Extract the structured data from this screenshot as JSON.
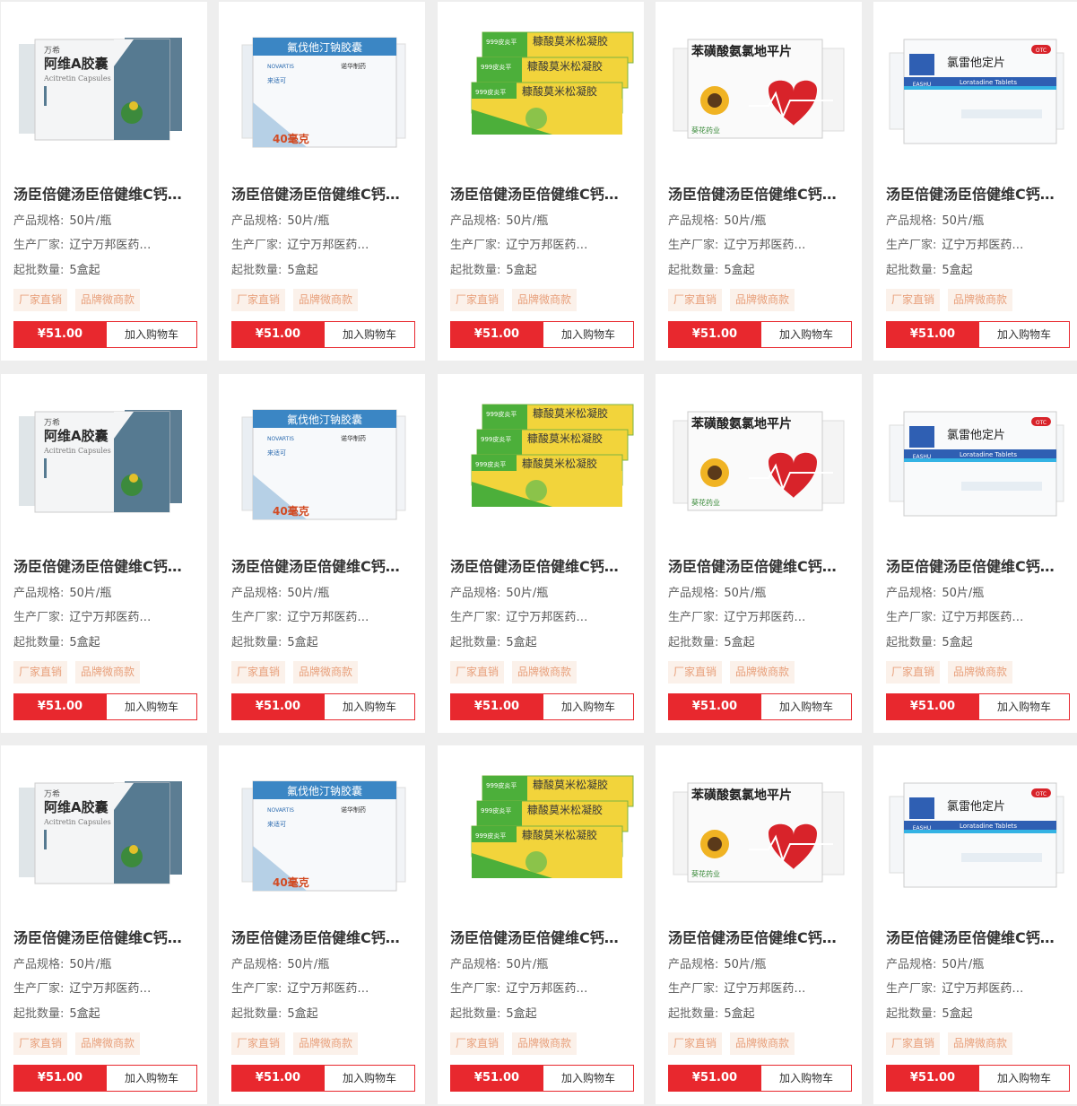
{
  "rows": 3,
  "products": [
    {
      "box_text": "阿维A胶囊",
      "box_sub": "Acitretin Capsules",
      "brand": "万希",
      "image_type": "acitretin",
      "name": "汤臣倍健汤臣倍健维C钙…",
      "spec_label": "产品规格:",
      "spec": "50片/瓶",
      "mfr_label": "生产厂家:",
      "mfr": "辽宁万邦医药…",
      "moq_label": "起批数量:",
      "moq": "5盒起",
      "tags": [
        "厂家直销",
        "品牌微商款"
      ],
      "price": "¥51.00",
      "cart_label": "加入购物车"
    },
    {
      "box_text": "氟伐他汀钠胶囊",
      "box_sub": "NOVARTIS",
      "brand": "诺华制药",
      "extra": "来适可",
      "dose": "40毫克",
      "image_type": "fluvastatin",
      "name": "汤臣倍健汤臣倍健维C钙…",
      "spec_label": "产品规格:",
      "spec": "50片/瓶",
      "mfr_label": "生产厂家:",
      "mfr": "辽宁万邦医药…",
      "moq_label": "起批数量:",
      "moq": "5盒起",
      "tags": [
        "厂家直销",
        "品牌微商款"
      ],
      "price": "¥51.00",
      "cart_label": "加入购物车"
    },
    {
      "box_text": "糠酸莫米松凝胶",
      "box_sub": "999皮炎平",
      "image_type": "mometasone",
      "name": "汤臣倍健汤臣倍健维C钙…",
      "spec_label": "产品规格:",
      "spec": "50片/瓶",
      "mfr_label": "生产厂家:",
      "mfr": "辽宁万邦医药…",
      "moq_label": "起批数量:",
      "moq": "5盒起",
      "tags": [
        "厂家直销",
        "品牌微商款"
      ],
      "price": "¥51.00",
      "cart_label": "加入购物车"
    },
    {
      "box_text": "苯磺酸氨氯地平片",
      "box_sub": "葵花药业",
      "image_type": "amlodipine",
      "name": "汤臣倍健汤臣倍健维C钙…",
      "spec_label": "产品规格:",
      "spec": "50片/瓶",
      "mfr_label": "生产厂家:",
      "mfr": "辽宁万邦医药…",
      "moq_label": "起批数量:",
      "moq": "5盒起",
      "tags": [
        "厂家直销",
        "品牌微商款"
      ],
      "price": "¥51.00",
      "cart_label": "加入购物车"
    },
    {
      "box_text": "氯雷他定片",
      "box_sub": "Loratadine Tablets",
      "brand": "EASHU",
      "badge": "OTC",
      "image_type": "loratadine",
      "name": "汤臣倍健汤臣倍健维C钙…",
      "spec_label": "产品规格:",
      "spec": "50片/瓶",
      "mfr_label": "生产厂家:",
      "mfr": "辽宁万邦医药…",
      "moq_label": "起批数量:",
      "moq": "5盒起",
      "tags": [
        "厂家直销",
        "品牌微商款"
      ],
      "price": "¥51.00",
      "cart_label": "加入购物车"
    }
  ],
  "colors": {
    "accent": "#e8282e",
    "tag_text": "#e8a07b",
    "tag_bg": "#fbf1ea",
    "page_bg": "#eeeeee"
  }
}
